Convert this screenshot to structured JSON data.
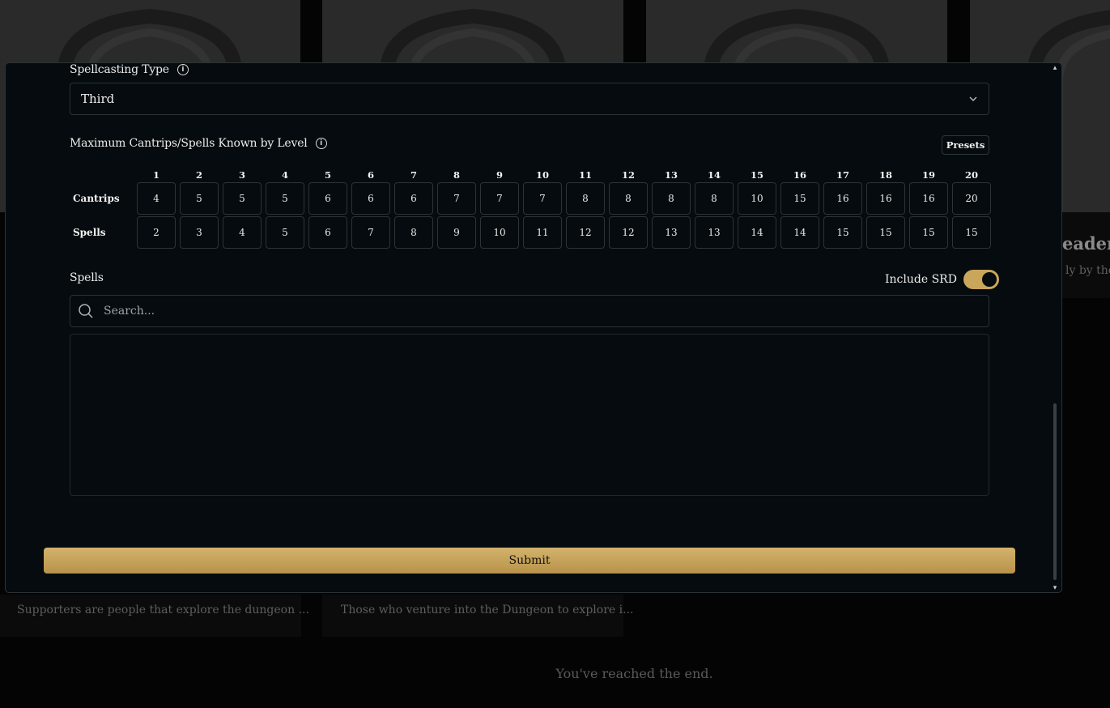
{
  "background": {
    "cards": [
      {
        "description": "Supporters are people that explore the dungeon ..."
      },
      {
        "description": "Those who venture into the Dungeon to explore i..."
      },
      {
        "title_partial": "eader",
        "description_partial": "ly by tho"
      }
    ],
    "end_message": "You've reached the end."
  },
  "modal": {
    "spellcasting_type": {
      "label": "Spellcasting Type",
      "value": "Third"
    },
    "spells_known": {
      "label": "Maximum Cantrips/Spells Known by Level",
      "presets_label": "Presets",
      "levels": [
        "1",
        "2",
        "3",
        "4",
        "5",
        "6",
        "7",
        "8",
        "9",
        "10",
        "11",
        "12",
        "13",
        "14",
        "15",
        "16",
        "17",
        "18",
        "19",
        "20"
      ],
      "rows": [
        {
          "label": "Cantrips",
          "values": [
            "4",
            "5",
            "5",
            "5",
            "6",
            "6",
            "6",
            "7",
            "7",
            "7",
            "8",
            "8",
            "8",
            "8",
            "10",
            "15",
            "16",
            "16",
            "16",
            "20"
          ]
        },
        {
          "label": "Spells",
          "values": [
            "2",
            "3",
            "4",
            "5",
            "6",
            "7",
            "8",
            "9",
            "10",
            "11",
            "12",
            "12",
            "13",
            "13",
            "14",
            "14",
            "15",
            "15",
            "15",
            "15"
          ]
        }
      ]
    },
    "spells": {
      "label": "Spells",
      "include_srd_label": "Include SRD",
      "include_srd_on": true,
      "search_placeholder": "Search..."
    },
    "submit_label": "Submit"
  },
  "colors": {
    "accent": "#c9a65a",
    "modal_bg": "#050b0e"
  }
}
